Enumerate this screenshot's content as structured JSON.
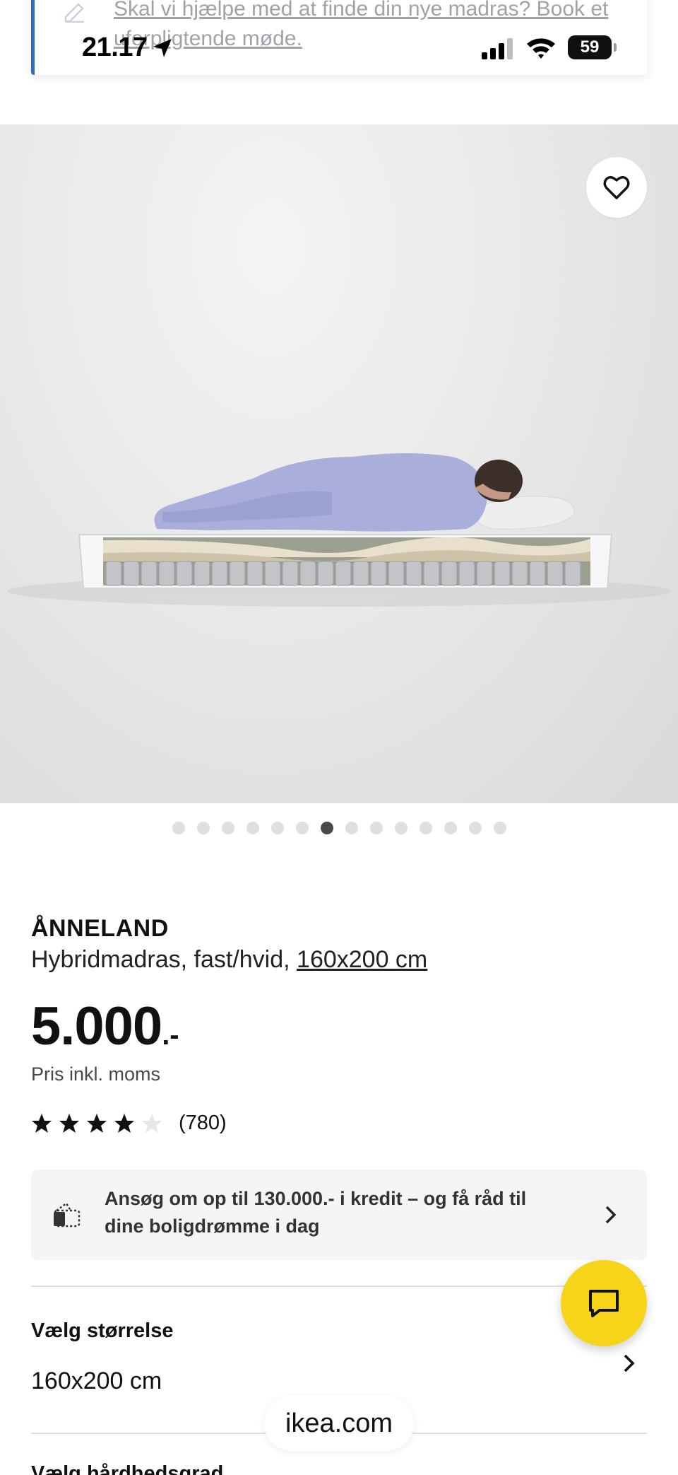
{
  "status_bar": {
    "time": "21.17",
    "battery": "59"
  },
  "banner": {
    "text": "Skal vi hjælpe med at finde din nye madras? Book et uforpligtende møde."
  },
  "hero": {
    "carousel": {
      "total": 14,
      "active_index": 6
    }
  },
  "product": {
    "name": "ÅNNELAND",
    "description": "Hybridmadras, fast/hvid, ",
    "size_link": "160x200 cm",
    "price_amount": "5.000",
    "price_suffix": ".-",
    "price_note": "Pris inkl. moms",
    "rating": {
      "value": 4,
      "max": 5,
      "count": "(780)"
    }
  },
  "credit": {
    "text": "Ansøg om op til 130.000.- i kredit – og få råd til dine boligdrømme i dag"
  },
  "size_selector": {
    "label": "Vælg størrelse",
    "value": "160x200 cm"
  },
  "next_section": {
    "heading": "Vælg hårdhedsgrad"
  },
  "browser": {
    "url": "ikea.com"
  },
  "colors": {
    "chat_button": "#f5d41a",
    "banner_accent": "#2d6fb8",
    "dot_active": "#4a4a4a",
    "dot_inactive": "#dfdfdf"
  },
  "icons": [
    "edit-pencil-icon",
    "location-arrow-icon",
    "signal-icon",
    "wifi-icon",
    "heart-icon",
    "star-icon",
    "credit-card-icon",
    "chevron-right-icon",
    "chat-icon"
  ]
}
